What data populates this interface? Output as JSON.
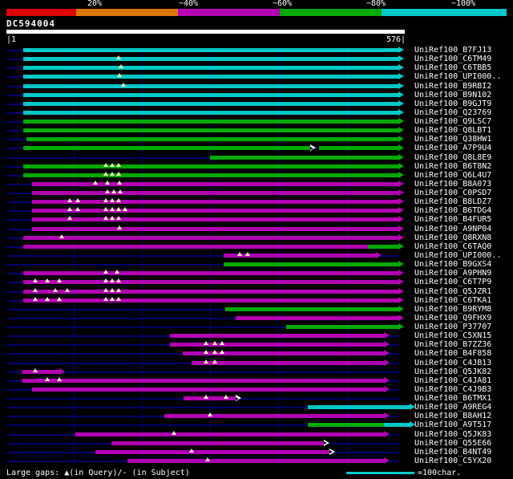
{
  "palette": {
    "red": "#dd0000",
    "orange": "#dd7700",
    "magenta": "#b300b3",
    "green": "#00aa00",
    "cyan": "#00c8c8",
    "navy": "#000070",
    "gap_marker": "#ffffbb",
    "white": "#ffffff"
  },
  "header": {
    "scale_labels": [
      "20%",
      "~40%",
      "~60%",
      "~80%",
      "~100%"
    ],
    "scale_colors": [
      "red",
      "orange",
      "magenta",
      "green",
      "cyan"
    ]
  },
  "query": {
    "id": "DC594004",
    "start_label": "|1",
    "end_label": "576|",
    "length": 576
  },
  "footer": {
    "gaps_legend": "Large gaps: ▲(in Query)/- (in Subject)",
    "scale_label": "=100char.",
    "scale_chars": 100
  },
  "chart_data": {
    "type": "bar",
    "orientation": "horizontal",
    "title": "DC594004",
    "x_range": [
      1,
      576
    ],
    "gridline_positions": [
      100,
      200,
      300,
      400,
      500
    ],
    "legend_position": "top",
    "rows": [
      {
        "label": "UniRef100_B7FJ13",
        "segments": [
          {
            "start": 26,
            "end": 576,
            "color": "cyan",
            "arrow": "solid"
          }
        ],
        "query_gaps": []
      },
      {
        "label": "UniRef100_C6TM49",
        "segments": [
          {
            "start": 26,
            "end": 576,
            "color": "cyan",
            "arrow": "solid"
          }
        ],
        "query_gaps": [
          165
        ]
      },
      {
        "label": "UniRef100_C6TBB5",
        "segments": [
          {
            "start": 26,
            "end": 576,
            "color": "cyan",
            "arrow": "solid"
          }
        ],
        "query_gaps": [
          169
        ]
      },
      {
        "label": "UniRef100_UPI000..",
        "segments": [
          {
            "start": 26,
            "end": 576,
            "color": "cyan",
            "arrow": "solid"
          }
        ],
        "query_gaps": [
          167
        ]
      },
      {
        "label": "UniRef100_B9RBI2",
        "segments": [
          {
            "start": 26,
            "end": 576,
            "color": "cyan",
            "arrow": "solid"
          }
        ],
        "query_gaps": [
          173
        ]
      },
      {
        "label": "UniRef100_B9N102",
        "segments": [
          {
            "start": 26,
            "end": 576,
            "color": "cyan",
            "arrow": "solid"
          }
        ],
        "query_gaps": []
      },
      {
        "label": "UniRef100_B9GJT9",
        "segments": [
          {
            "start": 26,
            "end": 576,
            "color": "cyan",
            "arrow": "solid"
          }
        ],
        "query_gaps": []
      },
      {
        "label": "UniRef100_Q23769",
        "segments": [
          {
            "start": 26,
            "end": 576,
            "color": "cyan",
            "arrow": "solid"
          }
        ],
        "query_gaps": []
      },
      {
        "label": "UniRef100_Q9LSC7",
        "segments": [
          {
            "start": 26,
            "end": 576,
            "color": "green",
            "arrow": "solid"
          }
        ],
        "query_gaps": []
      },
      {
        "label": "UniRef100_Q8LBT1",
        "segments": [
          {
            "start": 26,
            "end": 576,
            "color": "green",
            "arrow": "solid"
          }
        ],
        "query_gaps": []
      },
      {
        "label": "UniRef100_Q38HW1",
        "segments": [
          {
            "start": 30,
            "end": 576,
            "color": "green",
            "arrow": "solid"
          }
        ],
        "query_gaps": []
      },
      {
        "label": "UniRef100_A7P9U4",
        "segments": [
          {
            "start": 26,
            "end": 447,
            "color": "green",
            "arrow": "hollow"
          },
          {
            "start": 459,
            "end": 576,
            "color": "green",
            "arrow": "solid"
          }
        ],
        "query_gaps": []
      },
      {
        "label": "UniRef100_Q8L8E9",
        "segments": [
          {
            "start": 299,
            "end": 576,
            "color": "green",
            "arrow": "solid"
          }
        ],
        "query_gaps": []
      },
      {
        "label": "UniRef100_B6T8N2",
        "segments": [
          {
            "start": 26,
            "end": 576,
            "color": "green",
            "arrow": "solid"
          }
        ],
        "query_gaps": [
          147,
          156,
          166
        ]
      },
      {
        "label": "UniRef100_Q6L4U7",
        "segments": [
          {
            "start": 26,
            "end": 576,
            "color": "green",
            "arrow": "solid"
          }
        ],
        "query_gaps": [
          147,
          156,
          166
        ]
      },
      {
        "label": "UniRef100_B8A073",
        "segments": [
          {
            "start": 38,
            "end": 576,
            "color": "magenta",
            "arrow": "solid"
          }
        ],
        "query_gaps": [
          132,
          149,
          167
        ]
      },
      {
        "label": "UniRef100_C0PSD7",
        "segments": [
          {
            "start": 38,
            "end": 576,
            "color": "magenta",
            "arrow": "solid"
          }
        ],
        "query_gaps": [
          149,
          159,
          168
        ]
      },
      {
        "label": "UniRef100_B8LDZ7",
        "segments": [
          {
            "start": 38,
            "end": 576,
            "color": "magenta",
            "arrow": "solid"
          }
        ],
        "query_gaps": [
          94,
          106,
          147,
          156,
          166
        ]
      },
      {
        "label": "UniRef100_B6TDG4",
        "segments": [
          {
            "start": 38,
            "end": 576,
            "color": "magenta",
            "arrow": "solid"
          }
        ],
        "query_gaps": [
          94,
          106,
          147,
          156,
          166,
          175
        ]
      },
      {
        "label": "UniRef100_B4FUR5",
        "segments": [
          {
            "start": 38,
            "end": 576,
            "color": "magenta",
            "arrow": "solid"
          }
        ],
        "query_gaps": [
          94,
          147,
          156,
          166
        ]
      },
      {
        "label": "UniRef100_A9NP04",
        "segments": [
          {
            "start": 38,
            "end": 576,
            "color": "magenta",
            "arrow": "solid"
          }
        ],
        "query_gaps": [
          167
        ]
      },
      {
        "label": "UniRef100_Q8RXN8",
        "segments": [
          {
            "start": 26,
            "end": 576,
            "color": "magenta",
            "arrow": "solid"
          }
        ],
        "query_gaps": [
          82
        ]
      },
      {
        "label": "UniRef100_C6TAQ0",
        "segments": [
          {
            "start": 26,
            "end": 531,
            "color": "magenta",
            "arrow": "none"
          },
          {
            "start": 531,
            "end": 576,
            "color": "green",
            "arrow": "solid"
          }
        ],
        "query_gaps": []
      },
      {
        "label": "UniRef100_UPI000..",
        "segments": [
          {
            "start": 320,
            "end": 543,
            "color": "magenta",
            "arrow": "solid"
          }
        ],
        "query_gaps": [
          343,
          355
        ]
      },
      {
        "label": "UniRef100_B9GXS4",
        "segments": [
          {
            "start": 320,
            "end": 576,
            "color": "green",
            "arrow": "solid"
          }
        ],
        "query_gaps": []
      },
      {
        "label": "UniRef100_A9PHN9",
        "segments": [
          {
            "start": 26,
            "end": 576,
            "color": "magenta",
            "arrow": "solid"
          }
        ],
        "query_gaps": [
          147,
          163
        ]
      },
      {
        "label": "UniRef100_C6T7P9",
        "segments": [
          {
            "start": 26,
            "end": 576,
            "color": "magenta",
            "arrow": "solid"
          }
        ],
        "query_gaps": [
          43,
          61,
          79,
          147,
          156,
          166
        ]
      },
      {
        "label": "UniRef100_Q5JZR1",
        "segments": [
          {
            "start": 26,
            "end": 576,
            "color": "magenta",
            "arrow": "solid"
          }
        ],
        "query_gaps": [
          43,
          73,
          90,
          147,
          156,
          166
        ]
      },
      {
        "label": "UniRef100_C6TKA1",
        "segments": [
          {
            "start": 26,
            "end": 576,
            "color": "magenta",
            "arrow": "solid"
          }
        ],
        "query_gaps": [
          43,
          61,
          79,
          147,
          156,
          166
        ]
      },
      {
        "label": "UniRef100_B9RYM8",
        "segments": [
          {
            "start": 322,
            "end": 576,
            "color": "green",
            "arrow": "solid"
          }
        ],
        "query_gaps": []
      },
      {
        "label": "UniRef100_Q9FHX9",
        "segments": [
          {
            "start": 337,
            "end": 576,
            "color": "magenta",
            "arrow": "solid"
          }
        ],
        "query_gaps": []
      },
      {
        "label": "UniRef100_P37707",
        "segments": [
          {
            "start": 411,
            "end": 576,
            "color": "green",
            "arrow": "solid"
          }
        ],
        "query_gaps": []
      },
      {
        "label": "UniRef100_C5XN15",
        "segments": [
          {
            "start": 241,
            "end": 555,
            "color": "magenta",
            "arrow": "solid"
          }
        ],
        "query_gaps": []
      },
      {
        "label": "UniRef100_B7ZZ36",
        "segments": [
          {
            "start": 241,
            "end": 555,
            "color": "magenta",
            "arrow": "solid"
          }
        ],
        "query_gaps": [
          294,
          306,
          317
        ]
      },
      {
        "label": "UniRef100_B4F858",
        "segments": [
          {
            "start": 259,
            "end": 555,
            "color": "magenta",
            "arrow": "solid"
          }
        ],
        "query_gaps": [
          294,
          306,
          317
        ]
      },
      {
        "label": "UniRef100_C4JB13",
        "segments": [
          {
            "start": 273,
            "end": 555,
            "color": "magenta",
            "arrow": "solid"
          }
        ],
        "query_gaps": [
          294,
          306
        ]
      },
      {
        "label": "UniRef100_Q5JK82",
        "segments": [
          {
            "start": 24,
            "end": 79,
            "color": "magenta",
            "arrow": "solid"
          }
        ],
        "query_gaps": [
          43
        ]
      },
      {
        "label": "UniRef100_C4JA81",
        "segments": [
          {
            "start": 24,
            "end": 555,
            "color": "magenta",
            "arrow": "solid"
          }
        ],
        "query_gaps": [
          61,
          79
        ]
      },
      {
        "label": "UniRef100_C4J9B3",
        "segments": [
          {
            "start": 38,
            "end": 555,
            "color": "magenta",
            "arrow": "solid"
          }
        ],
        "query_gaps": []
      },
      {
        "label": "UniRef100_B6TMX1",
        "segments": [
          {
            "start": 261,
            "end": 337,
            "color": "magenta",
            "arrow": "hollow"
          }
        ],
        "query_gaps": [
          294,
          323
        ]
      },
      {
        "label": "UniRef100_A9REG4",
        "segments": [
          {
            "start": 443,
            "end": 576,
            "color": "cyan",
            "arrow": "solid",
            "overflow": true
          }
        ],
        "query_gaps": []
      },
      {
        "label": "UniRef100_B8AH12",
        "segments": [
          {
            "start": 232,
            "end": 555,
            "color": "magenta",
            "arrow": "solid"
          }
        ],
        "query_gaps": [
          299
        ]
      },
      {
        "label": "UniRef100_A9T517",
        "segments": [
          {
            "start": 443,
            "end": 555,
            "color": "green",
            "arrow": "none"
          },
          {
            "start": 555,
            "end": 576,
            "color": "cyan",
            "arrow": "solid",
            "overflow": true
          }
        ],
        "query_gaps": []
      },
      {
        "label": "UniRef100_Q5JK83",
        "segments": [
          {
            "start": 102,
            "end": 555,
            "color": "magenta",
            "arrow": "solid"
          }
        ],
        "query_gaps": [
          247
        ]
      },
      {
        "label": "UniRef100_Q55E66",
        "segments": [
          {
            "start": 155,
            "end": 467,
            "color": "magenta",
            "arrow": "hollow"
          }
        ],
        "query_gaps": []
      },
      {
        "label": "UniRef100_B4NT49",
        "segments": [
          {
            "start": 132,
            "end": 475,
            "color": "magenta",
            "arrow": "hollow"
          }
        ],
        "query_gaps": [
          273
        ]
      },
      {
        "label": "UniRef100_C5YX20",
        "segments": [
          {
            "start": 179,
            "end": 555,
            "color": "magenta",
            "arrow": "solid"
          }
        ],
        "query_gaps": [
          296
        ]
      }
    ]
  }
}
